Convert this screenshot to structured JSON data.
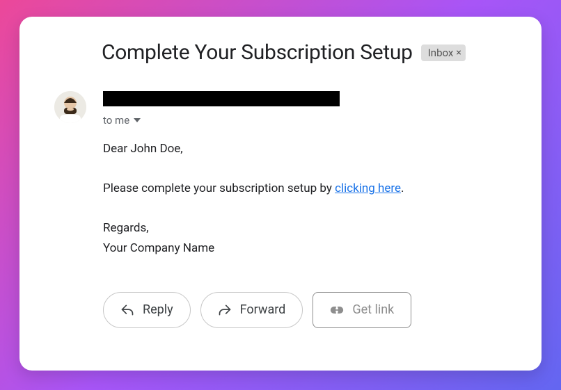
{
  "subject": "Complete Your Subscription Setup",
  "label": {
    "name": "Inbox"
  },
  "recipient_line": "to me",
  "body": {
    "greeting": "Dear John Doe,",
    "line1_pre": "Please complete your subscription setup by ",
    "link_text": "clicking here",
    "line1_post": ".",
    "signoff1": "Regards,",
    "signoff2": "Your Company Name"
  },
  "actions": {
    "reply": "Reply",
    "forward": "Forward",
    "getlink": "Get link"
  }
}
